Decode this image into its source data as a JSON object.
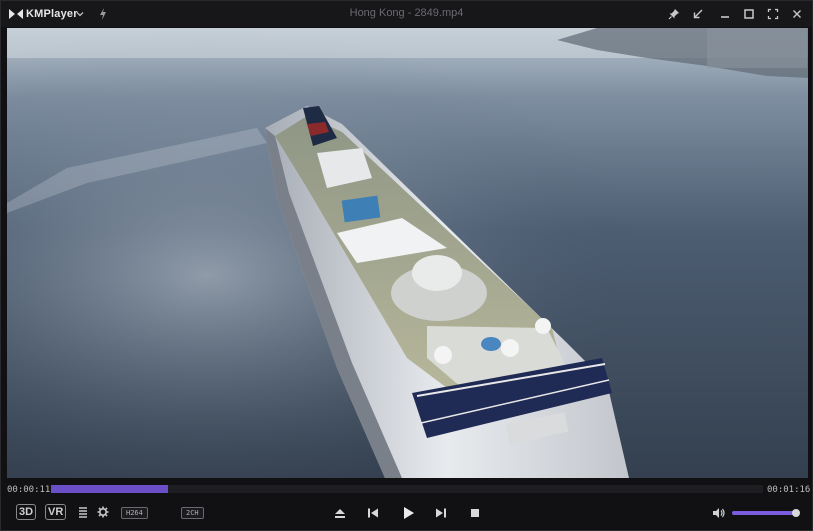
{
  "app": {
    "name": "KMPlayer",
    "file_title": "Hong Kong - 2849.mp4"
  },
  "playback": {
    "current_time": "00:00:11",
    "total_time": "00:01:16",
    "progress": 0.165,
    "volume": 0.97
  },
  "badges": {
    "codec": "H264",
    "channels": "2CH"
  },
  "buttons": {
    "three_d": "3D",
    "vr": "VR"
  },
  "colors": {
    "accent": "#6a4fc8",
    "bar_bg": "#111114",
    "title_text": "#6a6a70"
  }
}
